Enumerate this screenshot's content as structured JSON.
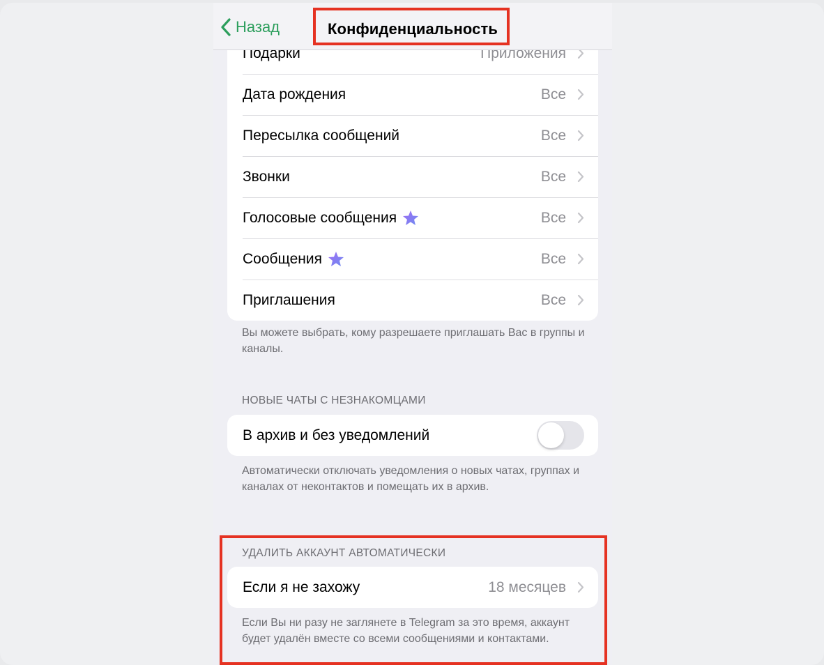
{
  "nav": {
    "back_label": "Назад",
    "title": "Конфиденциальность"
  },
  "privacy_items": [
    {
      "label": "Подарки",
      "value": "Приложения",
      "premium": false
    },
    {
      "label": "Дата рождения",
      "value": "Все",
      "premium": false
    },
    {
      "label": "Пересылка сообщений",
      "value": "Все",
      "premium": false
    },
    {
      "label": "Звонки",
      "value": "Все",
      "premium": false
    },
    {
      "label": "Голосовые сообщения",
      "value": "Все",
      "premium": true
    },
    {
      "label": "Сообщения",
      "value": "Все",
      "premium": true
    },
    {
      "label": "Приглашения",
      "value": "Все",
      "premium": false
    }
  ],
  "invites_footnote": "Вы можете выбрать, кому разрешаете приглашать Вас в группы и каналы.",
  "new_chats": {
    "header": "НОВЫЕ ЧАТЫ С НЕЗНАКОМЦАМИ",
    "toggle_label": "В архив и без уведомлений",
    "toggle_on": false,
    "footnote": "Автоматически отключать уведомления о новых чатах, группах и каналах от неконтактов и помещать их в архив."
  },
  "delete_account": {
    "header": "УДАЛИТЬ АККАУНТ АВТОМАТИЧЕСКИ",
    "row_label": "Если я не захожу",
    "row_value": "18 месяцев",
    "footnote": "Если Вы ни разу не заглянете в Telegram за это время, аккаунт будет удалён вместе со всеми сообщениями и контактами."
  },
  "colors": {
    "accent_green": "#2c9e5c",
    "highlight_red": "#e53222",
    "premium_star": "#8b6cf0"
  }
}
